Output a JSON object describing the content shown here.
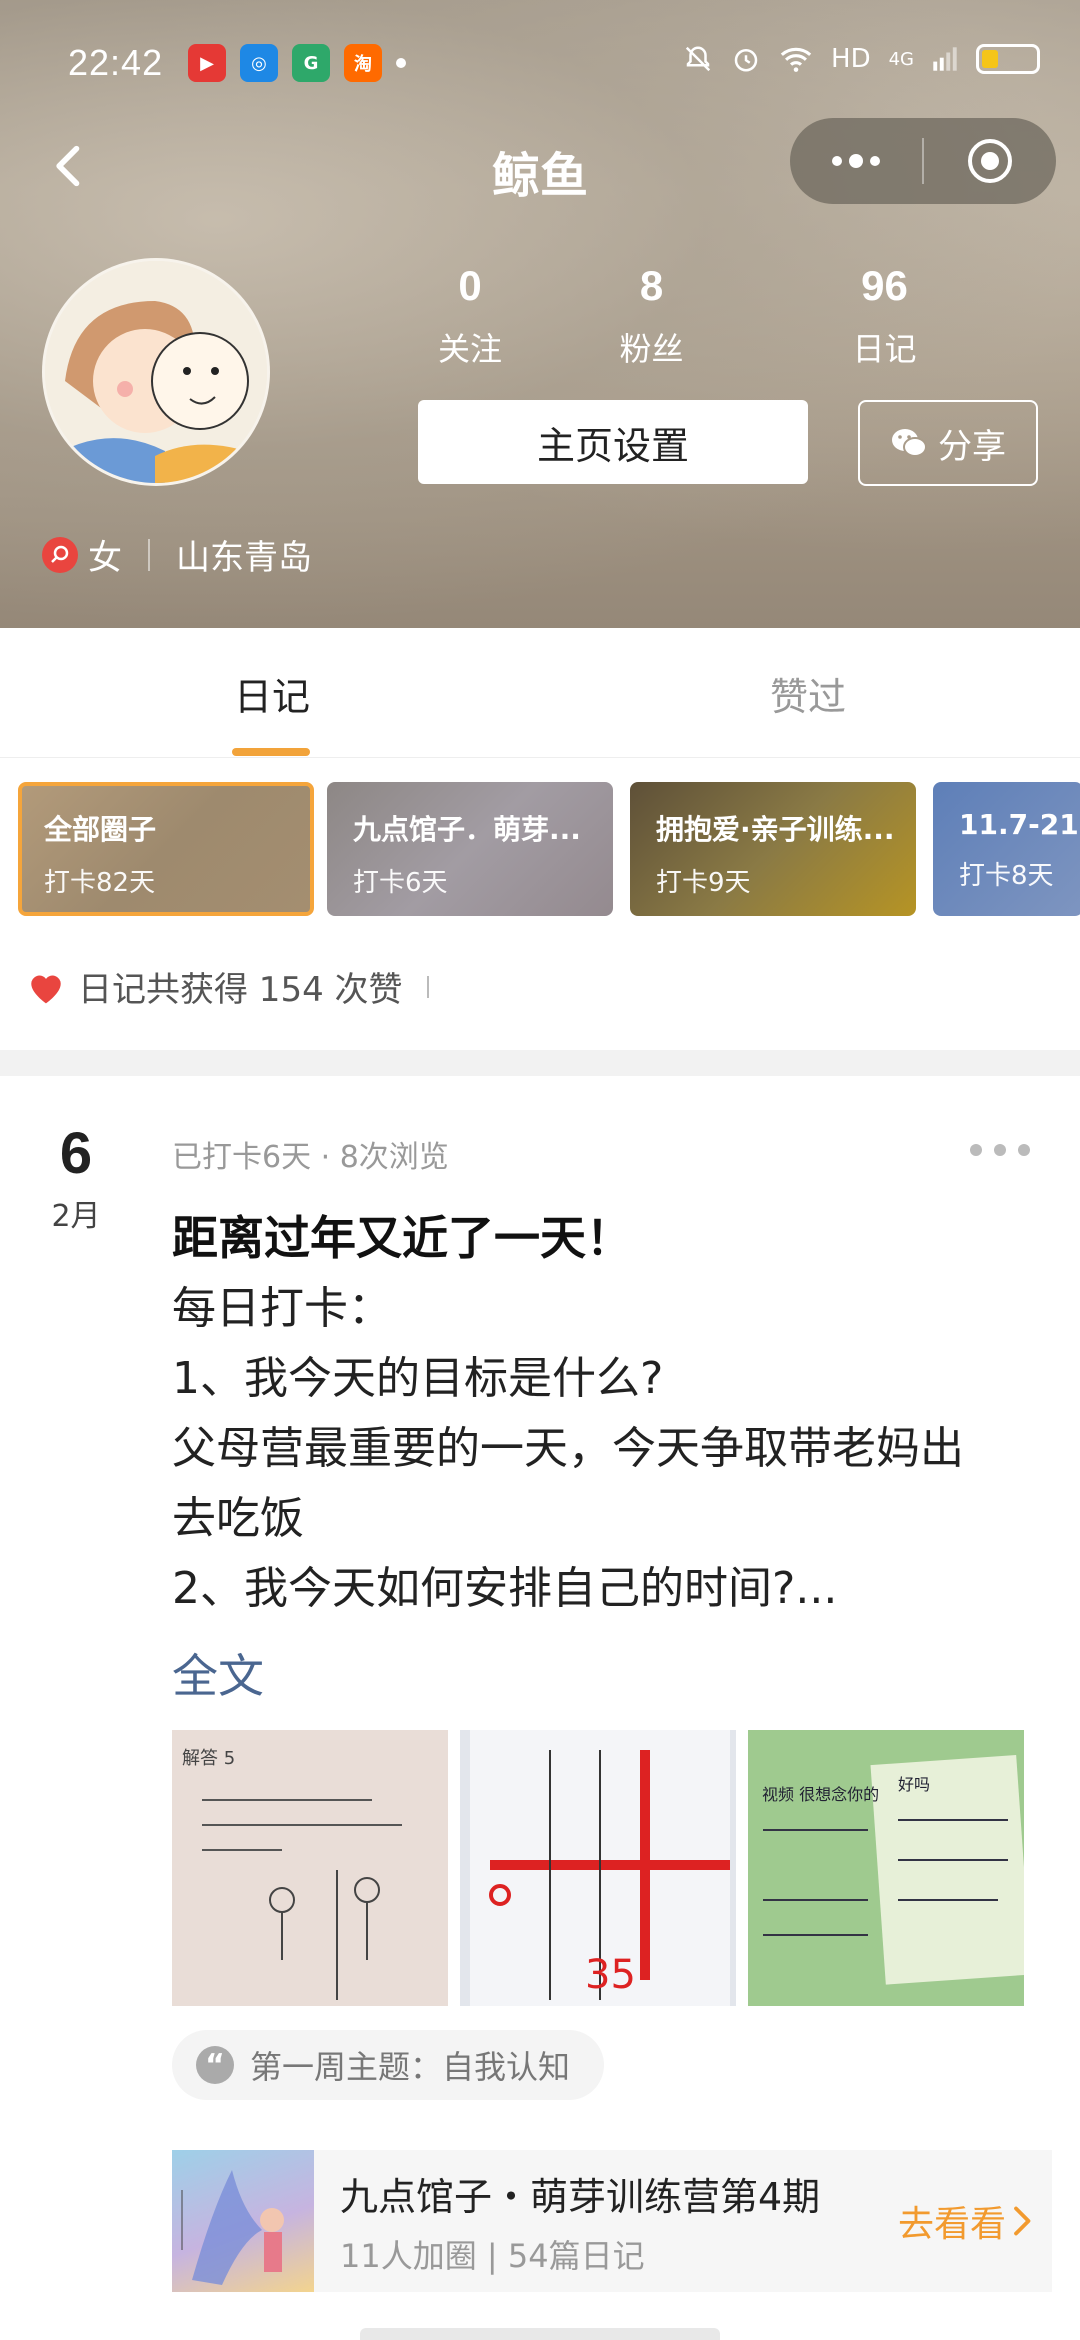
{
  "status_bar": {
    "time": "22:42",
    "apps": [
      {
        "icon": "video-app-icon",
        "color": "#e53935",
        "glyph": "▶"
      },
      {
        "icon": "browser-app-icon",
        "color": "#1e88e5",
        "glyph": "◎"
      },
      {
        "icon": "green-app-icon",
        "color": "#2ea86a",
        "glyph": "G"
      },
      {
        "icon": "taobao-app-icon",
        "color": "#ff6a00",
        "glyph": "淘"
      }
    ],
    "hd": "HD",
    "network": "4G",
    "battery_level": 0.3
  },
  "nav": {
    "title": "鲸鱼 ",
    "more_glyph": "•••"
  },
  "profile": {
    "stats": [
      {
        "value": "0",
        "label": "关注"
      },
      {
        "value": "8",
        "label": "粉丝"
      },
      {
        "value": "96",
        "label": "日记"
      }
    ],
    "settings_label": "主页设置",
    "share_label": "分享",
    "gender": "女",
    "location": "山东青岛"
  },
  "tabs": [
    {
      "label": "日记",
      "active": true
    },
    {
      "label": "赞过",
      "active": false
    }
  ],
  "circles": [
    {
      "name": "全部圈子",
      "sub": "打卡82天",
      "selected": true
    },
    {
      "name": "九点馆子．萌芽...",
      "sub": "打卡6天",
      "selected": false
    },
    {
      "name": "拥抱爱·亲子训练...",
      "sub": "打卡9天",
      "selected": false
    },
    {
      "name": "11.7-21",
      "sub": "打卡8天",
      "selected": false
    }
  ],
  "likes_summary": "日记共获得 154 次赞",
  "post": {
    "day": "6",
    "month": "2月",
    "meta": "已打卡6天 · 8次浏览",
    "title": "距离过年又近了一天！",
    "lines": [
      "每日打卡：",
      "1、我今天的目标是什么?",
      "父母营最重要的一天，今天争取带老妈出",
      "去吃饭",
      "2、我今天如何安排自己的时间?..."
    ],
    "full_text_link": "全文",
    "topic": "第一周主题：自我认知",
    "camp": {
      "name": "九点馆子・萌芽训练营第4期",
      "stats": "11人加圈 | 54篇日记",
      "go_label": "去看看"
    }
  },
  "photo_texts": {
    "p1_header": "解答 5",
    "p3_line1": "视频 很想念你的",
    "p3_line2": "好吗"
  },
  "colors": {
    "accent_orange": "#f2a33a",
    "link_blue": "#4a6690",
    "heart_red": "#e9453f"
  }
}
